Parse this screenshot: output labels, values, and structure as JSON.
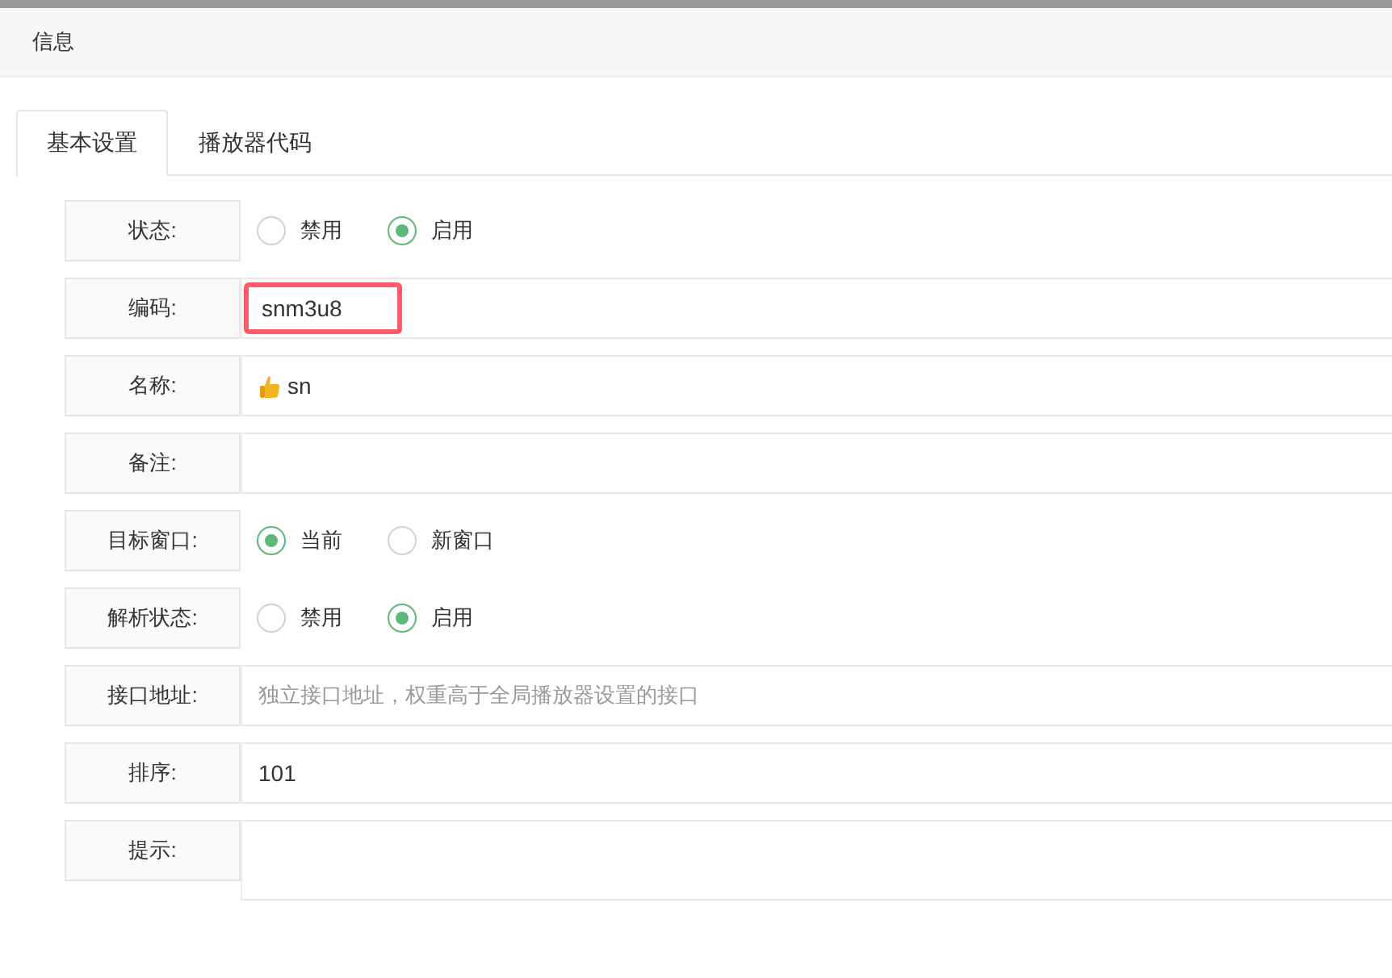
{
  "header": {
    "title": "信息"
  },
  "tabs": [
    {
      "label": "基本设置",
      "selected": true
    },
    {
      "label": "播放器代码",
      "selected": false
    }
  ],
  "rows": [
    {
      "label": "状态:",
      "kind": "radio",
      "options": [
        {
          "label": "禁用",
          "selected": false
        },
        {
          "label": "启用",
          "selected": true
        }
      ]
    },
    {
      "label": "编码:",
      "kind": "text",
      "value": "snm3u8",
      "highlighted": true
    },
    {
      "label": "名称:",
      "kind": "text",
      "value": "sn",
      "has_icon": true
    },
    {
      "label": "备注:",
      "kind": "text"
    },
    {
      "label": "目标窗口:",
      "kind": "radio",
      "options": [
        {
          "label": "当前",
          "selected": true
        },
        {
          "label": "新窗口",
          "selected": false
        }
      ]
    },
    {
      "label": "解析状态:",
      "kind": "radio",
      "options": [
        {
          "label": "禁用",
          "selected": false
        },
        {
          "label": "启用",
          "selected": true
        }
      ]
    },
    {
      "label": "接口地址:",
      "kind": "text",
      "placeholder": "独立接口地址，权重高于全局播放器设置的接口"
    },
    {
      "label": "排序:",
      "kind": "text",
      "value": "101"
    },
    {
      "label": "提示:",
      "kind": "textarea"
    }
  ]
}
